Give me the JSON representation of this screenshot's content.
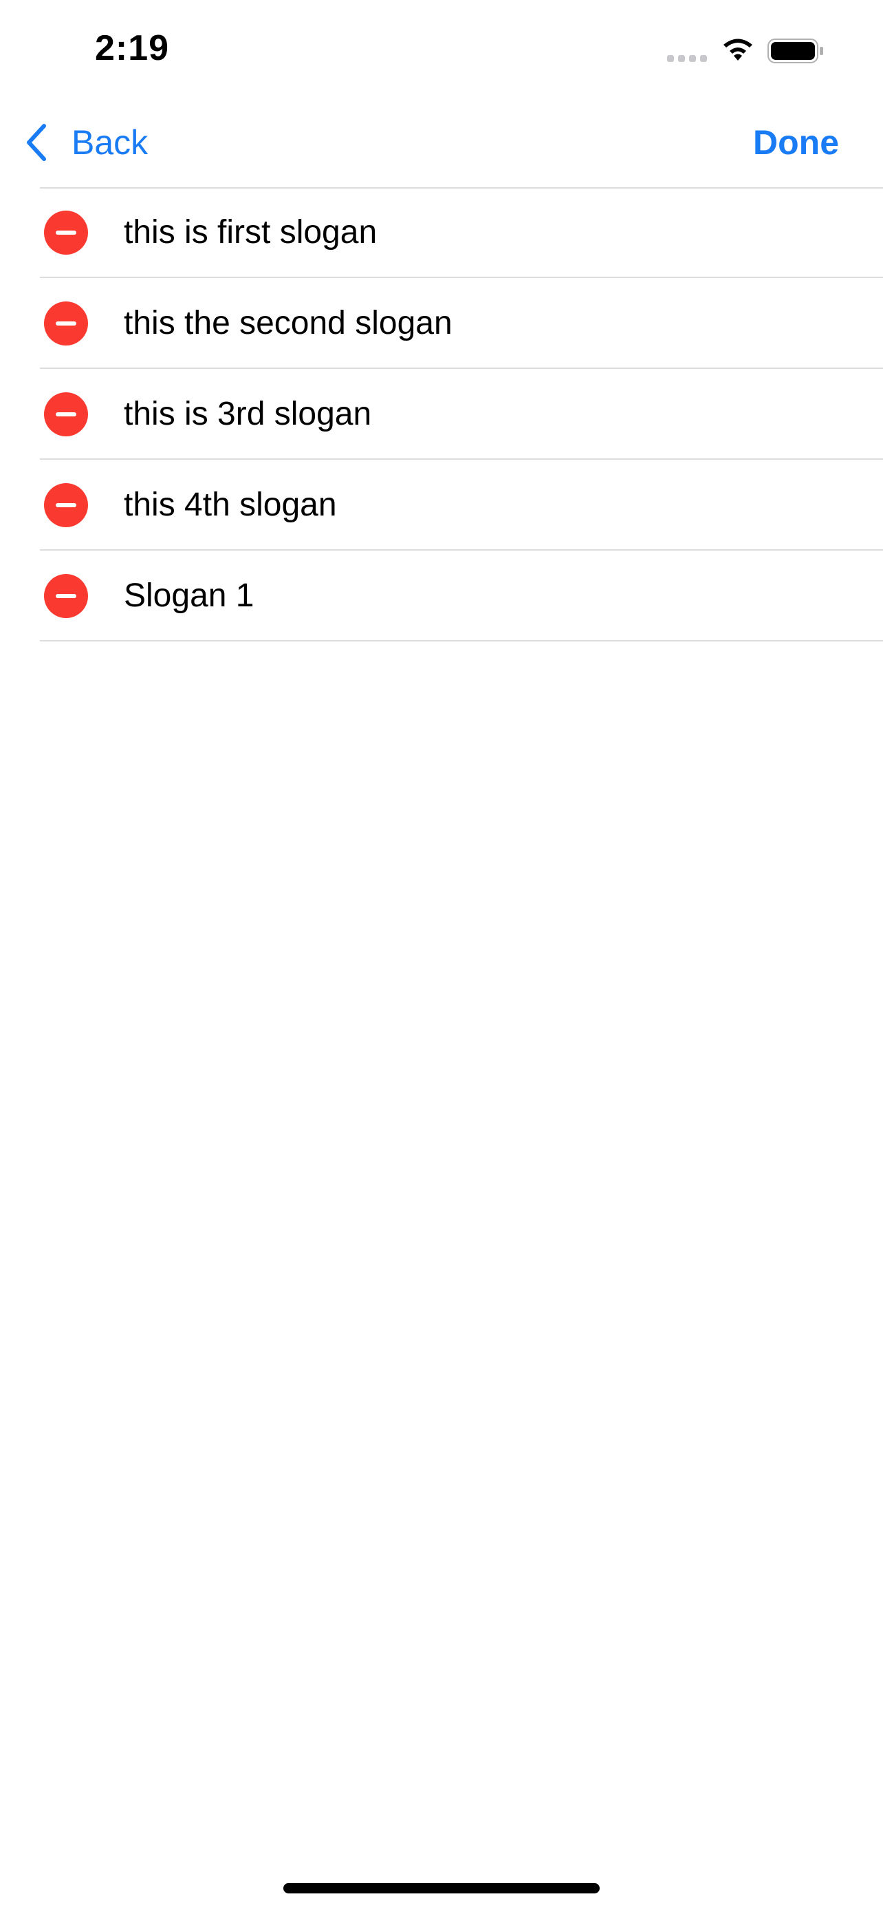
{
  "status_bar": {
    "time": "2:19"
  },
  "nav": {
    "back_label": "Back",
    "done_label": "Done"
  },
  "colors": {
    "accent": "#1a7cf5",
    "destructive": "#fa3a30",
    "separator": "#dcdcdf"
  },
  "list": {
    "items": [
      {
        "label": "this is first slogan"
      },
      {
        "label": "this the second slogan"
      },
      {
        "label": "this is 3rd slogan"
      },
      {
        "label": "this 4th slogan"
      },
      {
        "label": "Slogan 1"
      }
    ]
  }
}
